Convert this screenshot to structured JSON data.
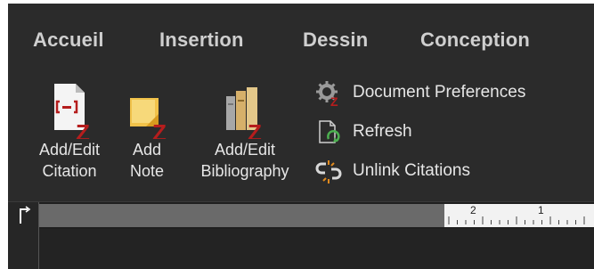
{
  "tabs": [
    {
      "label": "Accueil"
    },
    {
      "label": "Insertion"
    },
    {
      "label": "Dessin"
    },
    {
      "label": "Conception"
    }
  ],
  "ribbon": {
    "add_edit_citation": {
      "line1": "Add/Edit",
      "line2": "Citation",
      "icon": "citation-doc-icon"
    },
    "add_note": {
      "line1": "Add",
      "line2": "Note",
      "icon": "sticky-note-icon"
    },
    "add_edit_bibliography": {
      "line1": "Add/Edit",
      "line2": "Bibliography",
      "icon": "books-icon"
    },
    "document_preferences": {
      "label": "Document Preferences",
      "icon": "gear-zotero-icon"
    },
    "refresh": {
      "label": "Refresh",
      "icon": "refresh-doc-icon"
    },
    "unlink_citations": {
      "label": "Unlink Citations",
      "icon": "broken-link-icon"
    }
  },
  "ruler": {
    "marks": [
      "2",
      "1"
    ]
  },
  "colors": {
    "zotero_red": "#b51d1d",
    "background": "#2b2b2b",
    "text": "#e6e6e6",
    "tab_text": "#cfcfcf"
  }
}
